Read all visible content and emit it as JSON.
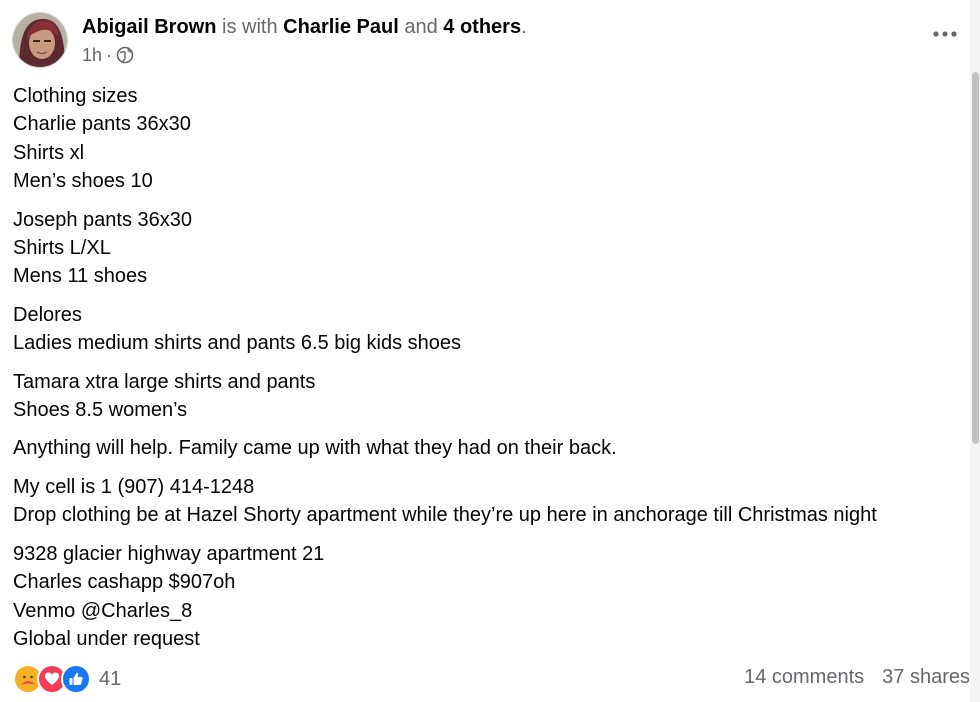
{
  "post": {
    "author": "Abigail Brown",
    "with_text": "is with",
    "tagged": "Charlie Paul",
    "and_text": "and",
    "others": "4 others",
    "period": ".",
    "time": "1h",
    "separator": "·",
    "audience_icon": "globe-icon",
    "more_icon": "more-options-icon"
  },
  "content": {
    "paragraphs": [
      [
        "Clothing sizes",
        "Charlie pants 36x30",
        "Shirts xl",
        "Men’s shoes 10"
      ],
      [
        "Joseph pants 36x30",
        "Shirts L/XL",
        "Mens 11 shoes"
      ],
      [
        "Delores",
        "Ladies medium shirts and pants 6.5 big kids shoes"
      ],
      [
        "Tamara xtra large shirts and pants",
        "Shoes 8.5 women’s"
      ],
      [
        "Anything will help. Family came up with what they had on their back."
      ],
      [
        "My cell is 1 (907) 414-1248",
        "Drop clothing be at Hazel Shorty apartment while they’re up here in anchorage till Christmas night"
      ],
      [
        "9328 glacier highway apartment 21",
        "Charles cashapp $907oh",
        "Venmo @Charles_8",
        "Global under request"
      ]
    ]
  },
  "engagement": {
    "reaction_icons": [
      "care-reaction-icon",
      "love-reaction-icon",
      "like-reaction-icon"
    ],
    "reaction_count": "41",
    "comments": "14 comments",
    "shares": "37 shares"
  },
  "colors": {
    "text": "#050505",
    "muted": "#65676b",
    "like_blue": "#1877f2",
    "love_red": "#f33e58",
    "care_yellow": "#f7b125"
  }
}
